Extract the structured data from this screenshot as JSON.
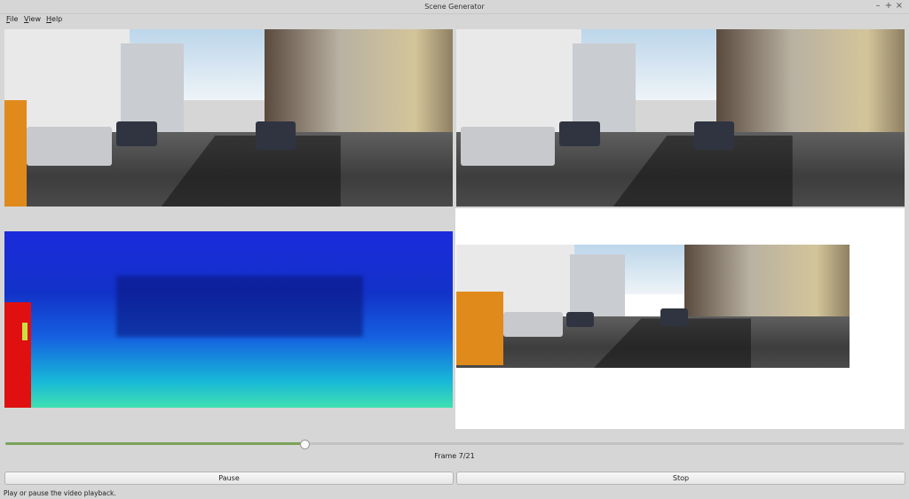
{
  "window": {
    "title": "Scene Generator",
    "controls": [
      "–",
      "+",
      "×"
    ]
  },
  "menu": [
    {
      "label": "File",
      "accel": "F",
      "rest": "ile"
    },
    {
      "label": "View",
      "accel": "V",
      "rest": "iew"
    },
    {
      "label": "Help",
      "accel": "H",
      "rest": "elp"
    }
  ],
  "panels": {
    "left_camera": {
      "icon": "street-scene-image"
    },
    "right_camera": {
      "icon": "street-scene-image"
    },
    "depth_map": {
      "icon": "depth-map-image"
    },
    "reprojected": {
      "icon": "street-scene-image"
    }
  },
  "playback": {
    "frame_label": "Frame 7/21",
    "progress_fraction": 0.333
  },
  "buttons": {
    "pause": "Pause",
    "stop": "Stop"
  },
  "status": "Play or pause the video playback.",
  "colors": {
    "accent": "#7aa35a"
  }
}
